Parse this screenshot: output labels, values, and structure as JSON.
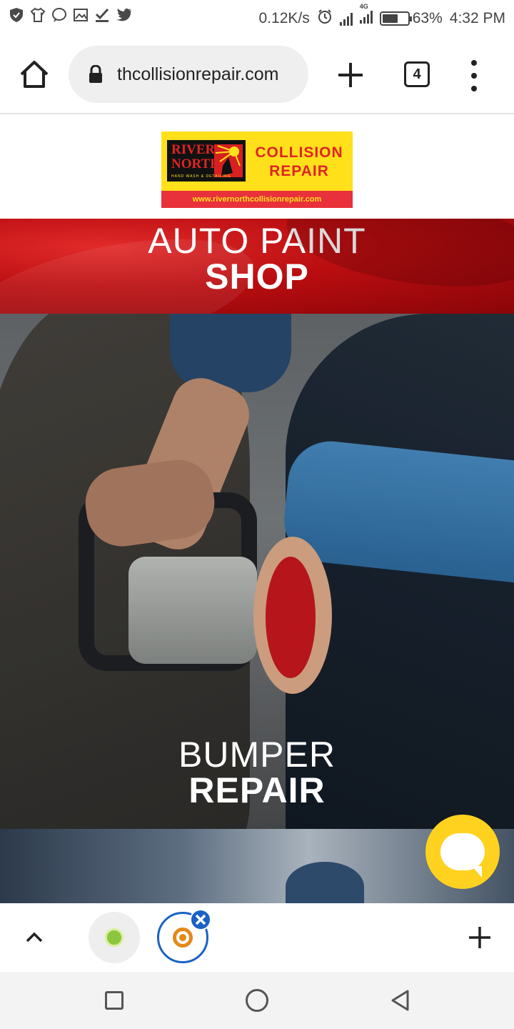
{
  "status_bar": {
    "network_speed": "0.12K/s",
    "network_type": "4G",
    "battery": "63%",
    "battery_level": 0.63,
    "time": "4:32 PM",
    "left_icons": [
      "shield-icon",
      "tshirt-icon",
      "chat-icon",
      "image-icon",
      "check-icon",
      "twitter-icon"
    ]
  },
  "browser": {
    "url": "thcollisionrepair.com",
    "tab_count": "4"
  },
  "logo": {
    "brand_left": "RIVER NORTH",
    "brand_right": "COLLISION REPAIR",
    "tagline": "HAND WASH & DETAILING",
    "url": "www.rivernorthcollisionrepair.com"
  },
  "banners": [
    {
      "line1": "AUTO PAINT",
      "line2": "SHOP"
    },
    {
      "line1": "BUMPER",
      "line2": "REPAIR"
    }
  ],
  "colors": {
    "logo_yellow": "#ffe01b",
    "logo_red": "#e02424",
    "chat_yellow": "#ffd21f",
    "active_tab_blue": "#1a63c4"
  }
}
